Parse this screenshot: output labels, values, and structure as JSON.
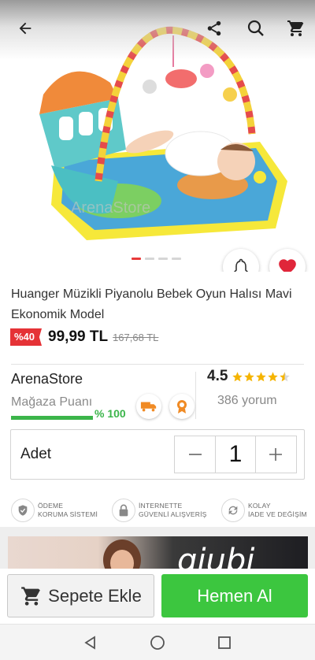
{
  "product": {
    "title": "Huanger Müzikli Piyanolu Bebek Oyun Halısı Mavi Ekonomik Model",
    "discount_badge": "%40",
    "price": "99,99 TL",
    "old_price": "167,68 TL",
    "image_watermark": "ArenaStore",
    "image_count": 4,
    "active_image_index": 1
  },
  "store": {
    "name": "ArenaStore",
    "score_label": "Mağaza Puanı",
    "score_percent_text": "% 100",
    "score_fraction": 1.0
  },
  "rating": {
    "value": "4.5",
    "stars": 4.5,
    "reviews": "386 yorum"
  },
  "quantity": {
    "label": "Adet",
    "value": "1",
    "minus_symbol": "−",
    "plus_symbol": "+"
  },
  "trust": [
    {
      "line1": "ÖDEME",
      "line2": "KORUMA SİSTEMİ",
      "icon": "shield-check-icon"
    },
    {
      "line1": "İNTERNETTE",
      "line2": "GÜVENLİ ALIŞVERİŞ",
      "icon": "lock-icon"
    },
    {
      "line1": "KOLAY",
      "line2": "İADE VE DEĞİŞİM",
      "icon": "refresh-icon"
    }
  ],
  "banner": {
    "text": "giubi"
  },
  "actions": {
    "add_to_cart": "Sepete Ekle",
    "buy_now": "Hemen Al"
  },
  "colors": {
    "accent_red": "#e53236",
    "success_green": "#3cc63f",
    "heart_red": "#e0263a"
  }
}
